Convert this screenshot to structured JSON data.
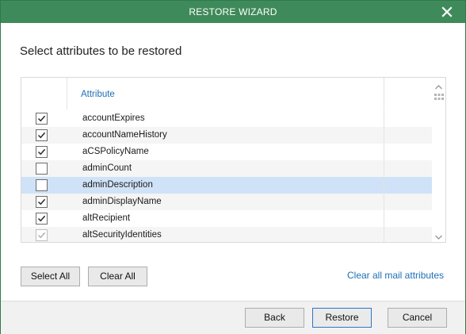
{
  "window": {
    "title": "RESTORE WIZARD"
  },
  "heading": "Select attributes to be restored",
  "grid": {
    "column_header": "Attribute",
    "rows": [
      {
        "name": "accountExpires",
        "checked": true,
        "enabled": true,
        "selected": false
      },
      {
        "name": "accountNameHistory",
        "checked": true,
        "enabled": true,
        "selected": false
      },
      {
        "name": "aCSPolicyName",
        "checked": true,
        "enabled": true,
        "selected": false
      },
      {
        "name": "adminCount",
        "checked": false,
        "enabled": true,
        "selected": false
      },
      {
        "name": "adminDescription",
        "checked": false,
        "enabled": true,
        "selected": true
      },
      {
        "name": "adminDisplayName",
        "checked": true,
        "enabled": true,
        "selected": false
      },
      {
        "name": "altRecipient",
        "checked": true,
        "enabled": true,
        "selected": false
      },
      {
        "name": "altSecurityIdentities",
        "checked": true,
        "enabled": false,
        "selected": false
      }
    ]
  },
  "buttons": {
    "select_all": "Select All",
    "clear_all": "Clear All",
    "back": "Back",
    "restore": "Restore",
    "cancel": "Cancel"
  },
  "link": {
    "clear_mail": "Clear all mail attributes"
  },
  "colors": {
    "titlebar": "#3f8a5a",
    "link": "#1f6fb5",
    "selected_row": "#cfe2f7",
    "primary_border": "#2b78c5"
  },
  "icons": {
    "close": "close-icon",
    "checkmark": "checkmark-icon",
    "scroll_up": "chevron-up-icon",
    "scroll_down": "chevron-down-icon",
    "scroll_grip": "grip-icon"
  }
}
